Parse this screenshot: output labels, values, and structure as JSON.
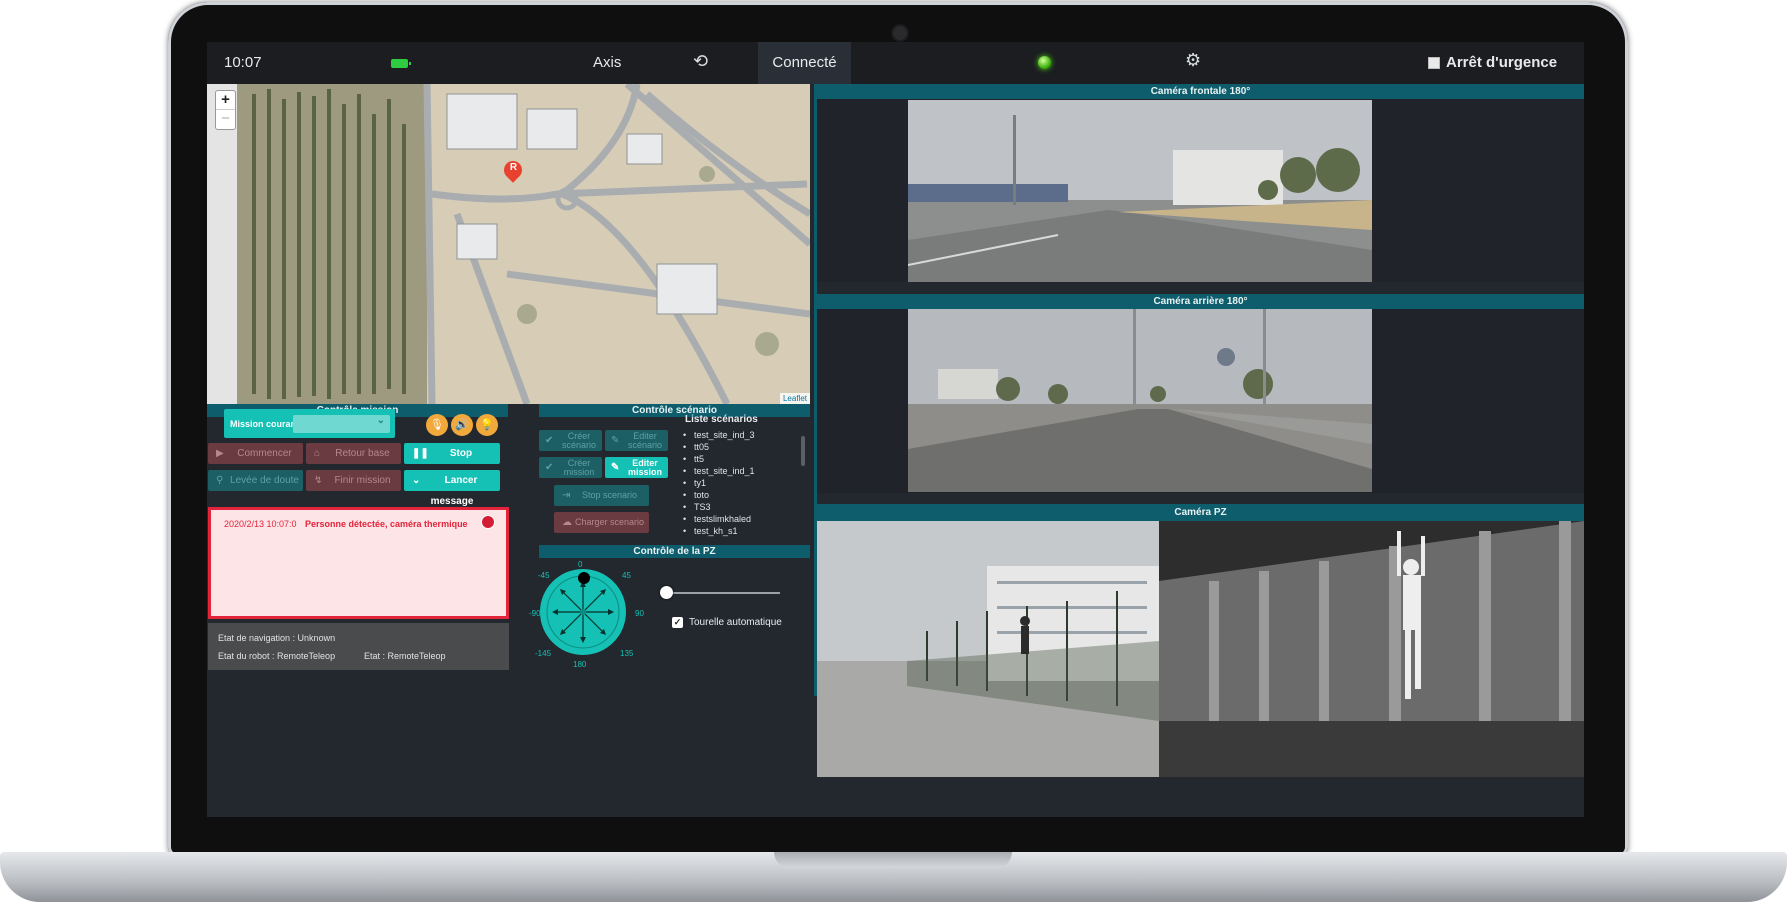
{
  "topbar": {
    "time": "10:07",
    "axis_label": "Axis",
    "connection_status": "Connecté",
    "emergency_label": "Arrêt d'urgence"
  },
  "map": {
    "zoom_in": "+",
    "zoom_out": "−",
    "marker_label": "R",
    "attribution": "Leaflet"
  },
  "mission_control": {
    "title": "Contrôle mission",
    "current_mission_label": "Mission courante :",
    "current_mission_value": "",
    "buttons": {
      "start": "Commencer",
      "return_base": "Retour base",
      "stop": "Stop",
      "doubt_removal": "Levée de doute",
      "finish": "Finir mission",
      "launch_message": "Lancer message"
    }
  },
  "alert": {
    "timestamp": "2020/2/13 10:07:0",
    "message": "Personne détectée, caméra thermique"
  },
  "state": {
    "navigation": "Etat de navigation : Unknown",
    "robot": "Etat du robot : RemoteTeleop",
    "status": "Etat : RemoteTeleop"
  },
  "scenario_control": {
    "title": "Contrôle scénario",
    "create_scenario_1": "Créer",
    "create_scenario_2": "scénario",
    "edit_scenario_1": "Editer",
    "edit_scenario_2": "scénario",
    "create_mission_1": "Créer",
    "create_mission_2": "mission",
    "edit_mission_1": "Editer",
    "edit_mission_2": "mission",
    "stop_scenario": "Stop scenario",
    "load_scenario": "Charger scenario",
    "list_title": "Liste scénarios",
    "scenarios": [
      "test_site_ind_3",
      "tt05",
      "tt5",
      "test_site_ind_1",
      "ty1",
      "toto",
      "TS3",
      "testslimkhaled",
      "test_kh_s1"
    ]
  },
  "pz_control": {
    "title": "Contrôle de la PZ",
    "angles": {
      "n": "0",
      "ne": "45",
      "e": "90",
      "se": "135",
      "s": "180",
      "sw": "-145",
      "w": "-90",
      "nw": "-45"
    },
    "turret_label": "Tourelle automatique",
    "turret_checked": true,
    "slider_value": 0
  },
  "cameras": {
    "front": "Caméra frontale 180°",
    "rear": "Caméra arrière 180°",
    "pz": "Caméra PZ"
  },
  "colors": {
    "accent": "#15c1b4",
    "header_bg": "#0e5d6c",
    "alert": "#e3243b",
    "warning": "#f2a93b"
  }
}
